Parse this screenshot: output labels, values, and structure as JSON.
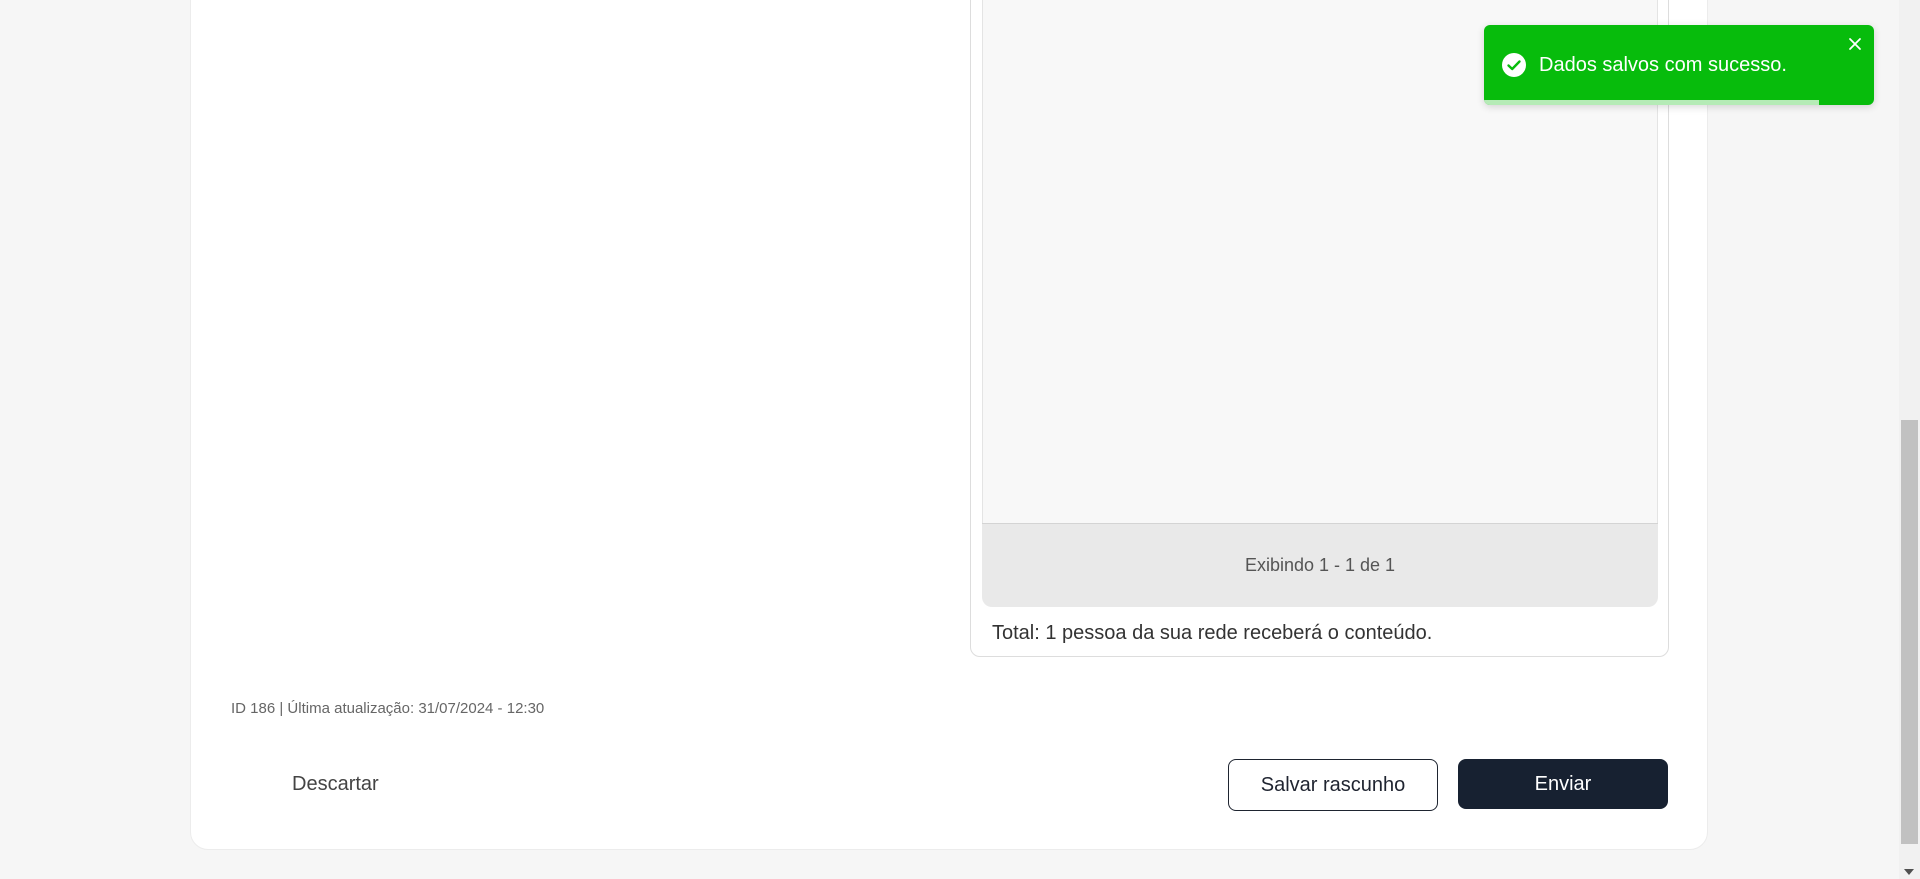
{
  "toast": {
    "message": "Dados salvos com sucesso.",
    "color": "#07bc0c",
    "progress": 0.86
  },
  "recipients": {
    "pagination_text": "Exibindo 1 - 1 de 1",
    "total_text": "Total: 1 pessoa da sua rede receberá o conteúdo."
  },
  "footer": {
    "meta": "ID 186 | Última atualização: 31/07/2024 - 12:30",
    "discard_label": "Descartar",
    "draft_label": "Salvar rascunho",
    "send_label": "Enviar"
  },
  "colors": {
    "primary": "#172131"
  }
}
